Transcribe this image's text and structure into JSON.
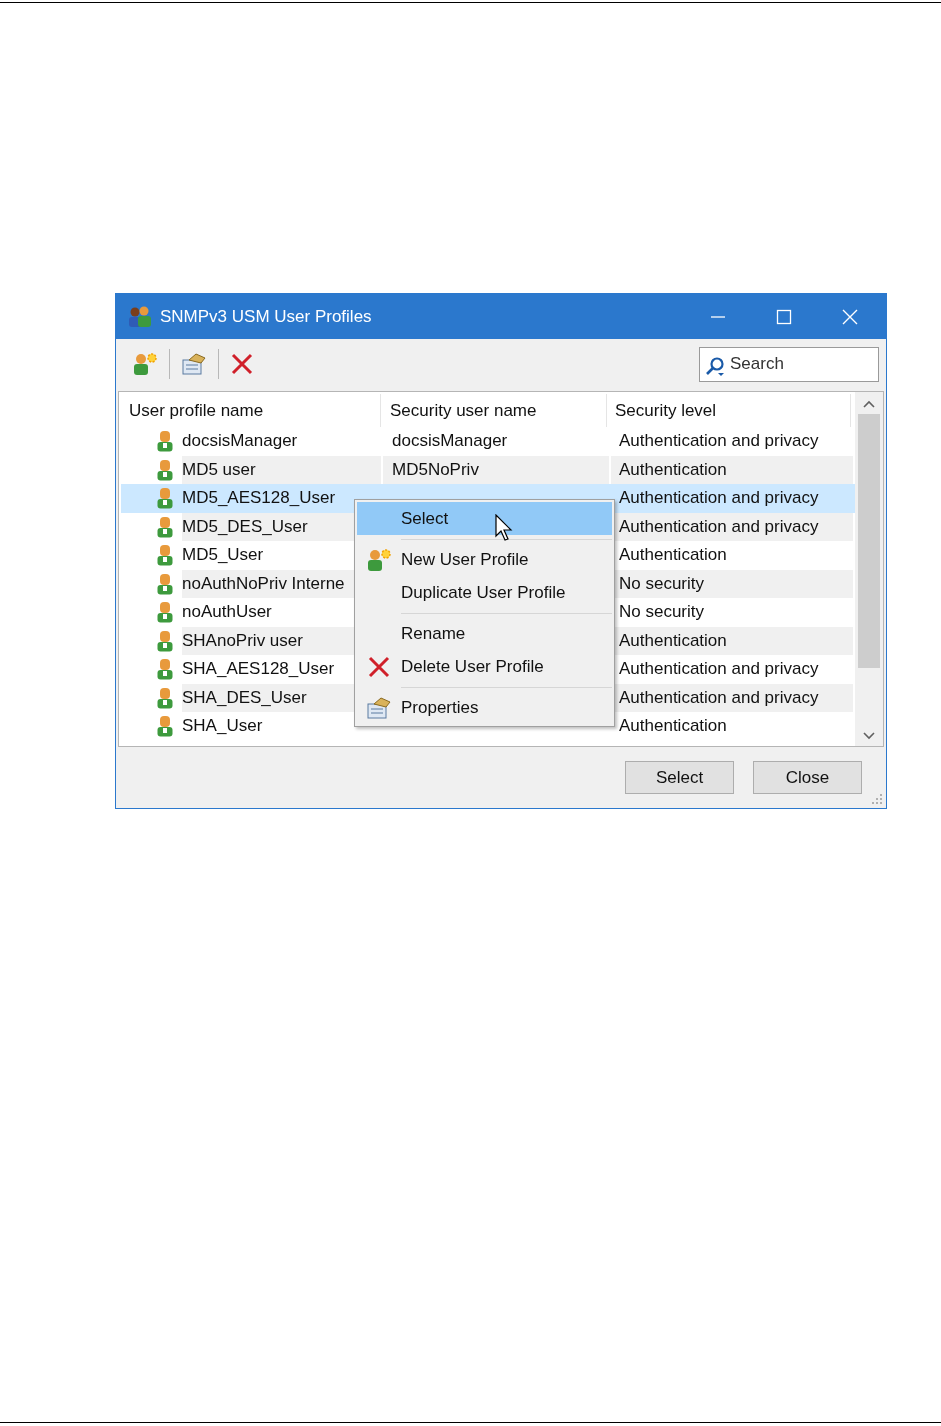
{
  "window": {
    "title": "SNMPv3 USM User Profiles"
  },
  "search": {
    "placeholder": "Search"
  },
  "table": {
    "columns": [
      "User profile name",
      "Security user name",
      "Security level"
    ],
    "rows": [
      {
        "name": "docsisManager",
        "security_user_name": "docsisManager",
        "security_level": "Authentication and privacy",
        "selected": false
      },
      {
        "name": "MD5 user",
        "security_user_name": "MD5NoPriv",
        "security_level": "Authentication",
        "selected": false
      },
      {
        "name": "MD5_AES128_User",
        "security_level": "Authentication and privacy",
        "selected": true
      },
      {
        "name": "MD5_DES_User",
        "security_level": "Authentication and privacy",
        "selected": false
      },
      {
        "name": "MD5_User",
        "security_level": "Authentication",
        "selected": false
      },
      {
        "name": "noAuthNoPriv Interne",
        "security_level": "No security",
        "selected": false
      },
      {
        "name": "noAuthUser",
        "security_level": "No security",
        "selected": false
      },
      {
        "name": "SHAnoPriv user",
        "security_level": "Authentication",
        "selected": false
      },
      {
        "name": "SHA_AES128_User",
        "security_level": "Authentication and privacy",
        "selected": false
      },
      {
        "name": "SHA_DES_User",
        "security_level": "Authentication and privacy",
        "selected": false
      },
      {
        "name": "SHA_User",
        "security_level": "Authentication",
        "selected": false
      }
    ]
  },
  "context_menu": {
    "items": [
      {
        "kind": "plain",
        "label": "Select",
        "selected": true
      },
      {
        "kind": "separator"
      },
      {
        "kind": "add",
        "label": "New User Profile",
        "selected": false
      },
      {
        "kind": "plain",
        "label": "Duplicate User Profile",
        "selected": false
      },
      {
        "kind": "separator"
      },
      {
        "kind": "plain",
        "label": "Rename",
        "selected": false
      },
      {
        "kind": "delete",
        "label": "Delete User Profile",
        "selected": false
      },
      {
        "kind": "separator"
      },
      {
        "kind": "properties",
        "label": "Properties",
        "selected": false
      }
    ]
  },
  "buttons": [
    "Select",
    "Close"
  ]
}
